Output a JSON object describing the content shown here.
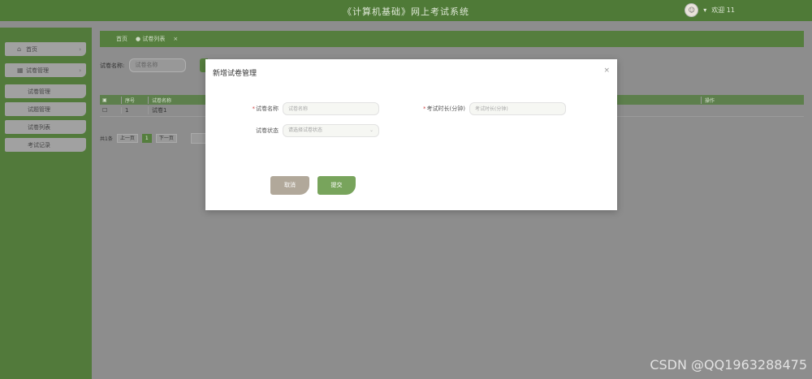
{
  "header": {
    "title": "《计算机基础》网上考试系统",
    "welcome": "欢迎 11"
  },
  "sidebar": {
    "items": [
      {
        "label": "首页"
      },
      {
        "label": "试卷管理"
      },
      {
        "label": "试卷管理"
      },
      {
        "label": "试题管理"
      },
      {
        "label": "试卷列表"
      },
      {
        "label": "考试记录"
      }
    ]
  },
  "breadcrumb": {
    "home": "首页",
    "current": "● 试卷列表",
    "close": "×"
  },
  "search": {
    "label": "试卷名称:",
    "placeholder": "试卷名称"
  },
  "table": {
    "headers": [
      "",
      "序号",
      "试卷名称",
      "操作"
    ],
    "rows": [
      {
        "index": "1",
        "name": "试卷1"
      }
    ]
  },
  "pager": {
    "total": "共1条",
    "prev": "上一页",
    "current": "1",
    "next": "下一页"
  },
  "modal": {
    "title": "新增试卷管理",
    "close": "×",
    "required_mark": "*",
    "name_label": "试卷名称",
    "name_placeholder": "试卷名称",
    "duration_label": "考试时长(分钟)",
    "duration_placeholder": "考试时长(分钟)",
    "status_label": "试卷状态",
    "status_placeholder": "请选择试卷状态",
    "cancel": "取消",
    "submit": "提交"
  },
  "watermark": "CSDN @QQ1963288475",
  "colors": {
    "primary": "#4f7a37",
    "submit": "#78a45c",
    "cancel": "#b1a89a",
    "overlay": "#8d8d8d"
  }
}
